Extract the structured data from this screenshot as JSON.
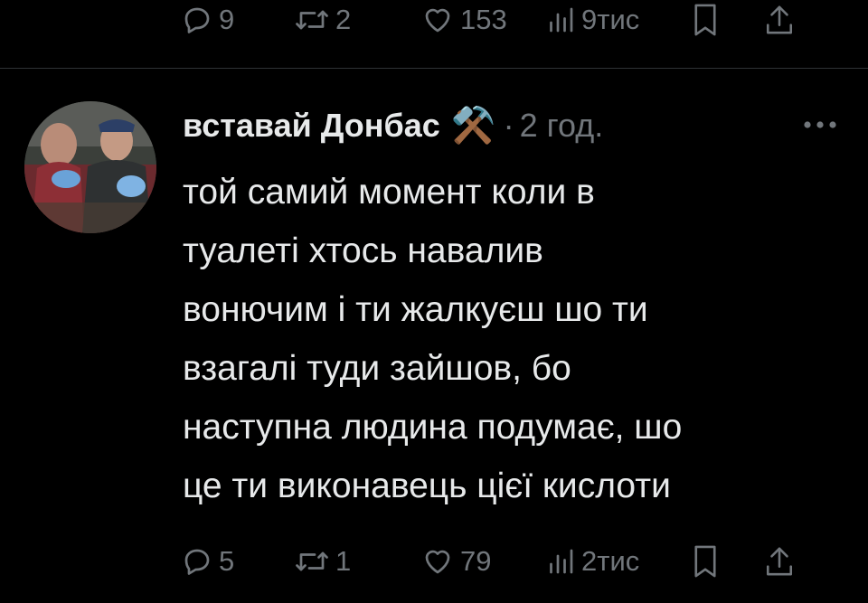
{
  "previous_post": {
    "actions": {
      "reply_count": "9",
      "repost_count": "2",
      "like_count": "153",
      "view_count": "9тис"
    }
  },
  "post": {
    "author": {
      "display_name": "вставай Донбас",
      "badge_emoji": "⚒️"
    },
    "separator": "·",
    "time": "2 год.",
    "more_icon": "more-horizontal-icon",
    "text": "той самий момент коли в\nтуалеті хтось навалив\nвонючим і ти жалкуєш шо ти\nвзагалі туди зайшов, бо\nнаступна людина подумає, шо\nце ти виконавець цієї кислоти",
    "actions": {
      "reply_count": "5",
      "repost_count": "1",
      "like_count": "79",
      "view_count": "2тис"
    }
  },
  "colors": {
    "background": "#000000",
    "text_primary": "#e7e9ea",
    "text_secondary": "#71767b",
    "divider": "#2f3336"
  }
}
